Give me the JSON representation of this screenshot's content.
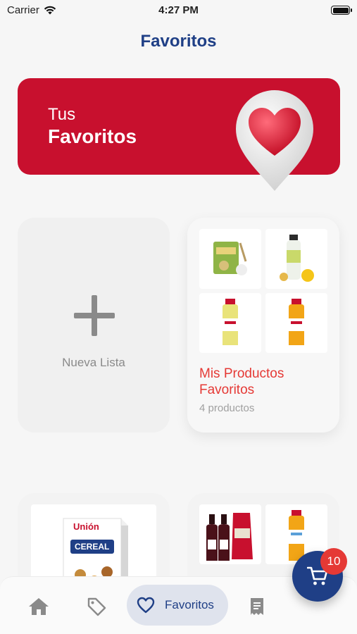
{
  "status_bar": {
    "carrier": "Carrier",
    "time": "4:27 PM"
  },
  "header": {
    "title": "Favoritos"
  },
  "hero": {
    "line1": "Tus",
    "line2": "Favoritos",
    "accent_color": "#c8102e"
  },
  "new_list": {
    "label": "Nueva Lista"
  },
  "favorites_list": {
    "title": "Mis Productos Favoritos",
    "count": "4 productos",
    "thumbnails": [
      "snack-bag",
      "coconut-drink-bottle",
      "juice-bottle-lemon",
      "juice-bottle-orange"
    ]
  },
  "more_lists": {
    "card1_thumbnail": "cereal-box",
    "card2_thumbnails": [
      "wine-bottles-pouch",
      "juice-bottle-orange"
    ],
    "cereal_brand": "Unión",
    "cereal_text": "CEREAL"
  },
  "tabbar": {
    "items": [
      "home-icon",
      "tag-icon",
      "heart-icon",
      "receipt-icon"
    ],
    "active_label": "Favoritos",
    "brand_color": "#1f3f86"
  },
  "cart": {
    "badge": "10"
  }
}
